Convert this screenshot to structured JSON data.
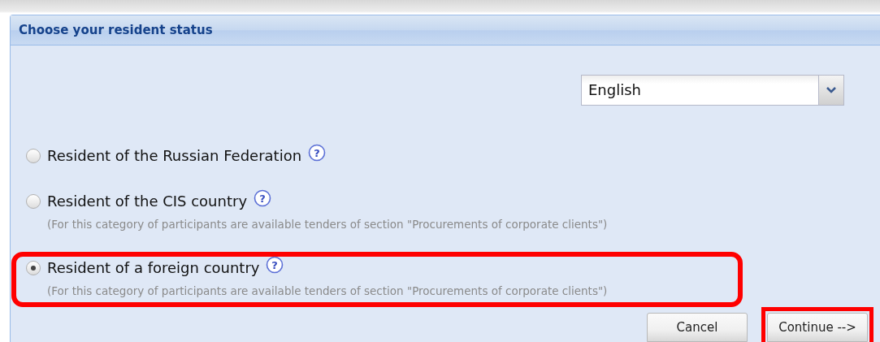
{
  "dialog": {
    "title": "Choose your resident status"
  },
  "language_select": {
    "value": "English"
  },
  "options": [
    {
      "label": "Resident of the Russian Federation",
      "help": "?",
      "selected": false,
      "highlighted": false
    },
    {
      "label": "Resident of the CIS country",
      "help": "?",
      "note": "(For this category of participants are available tenders of section \"Procurements of corporate clients\")",
      "selected": false,
      "highlighted": false
    },
    {
      "label": "Resident of a foreign country",
      "help": "?",
      "note": "(For this category of participants are available tenders of section \"Procurements of corporate clients\")",
      "selected": true,
      "highlighted": true
    }
  ],
  "buttons": [
    {
      "label": "Cancel",
      "highlighted": false
    },
    {
      "label": "Continue -->",
      "highlighted": true
    }
  ]
}
